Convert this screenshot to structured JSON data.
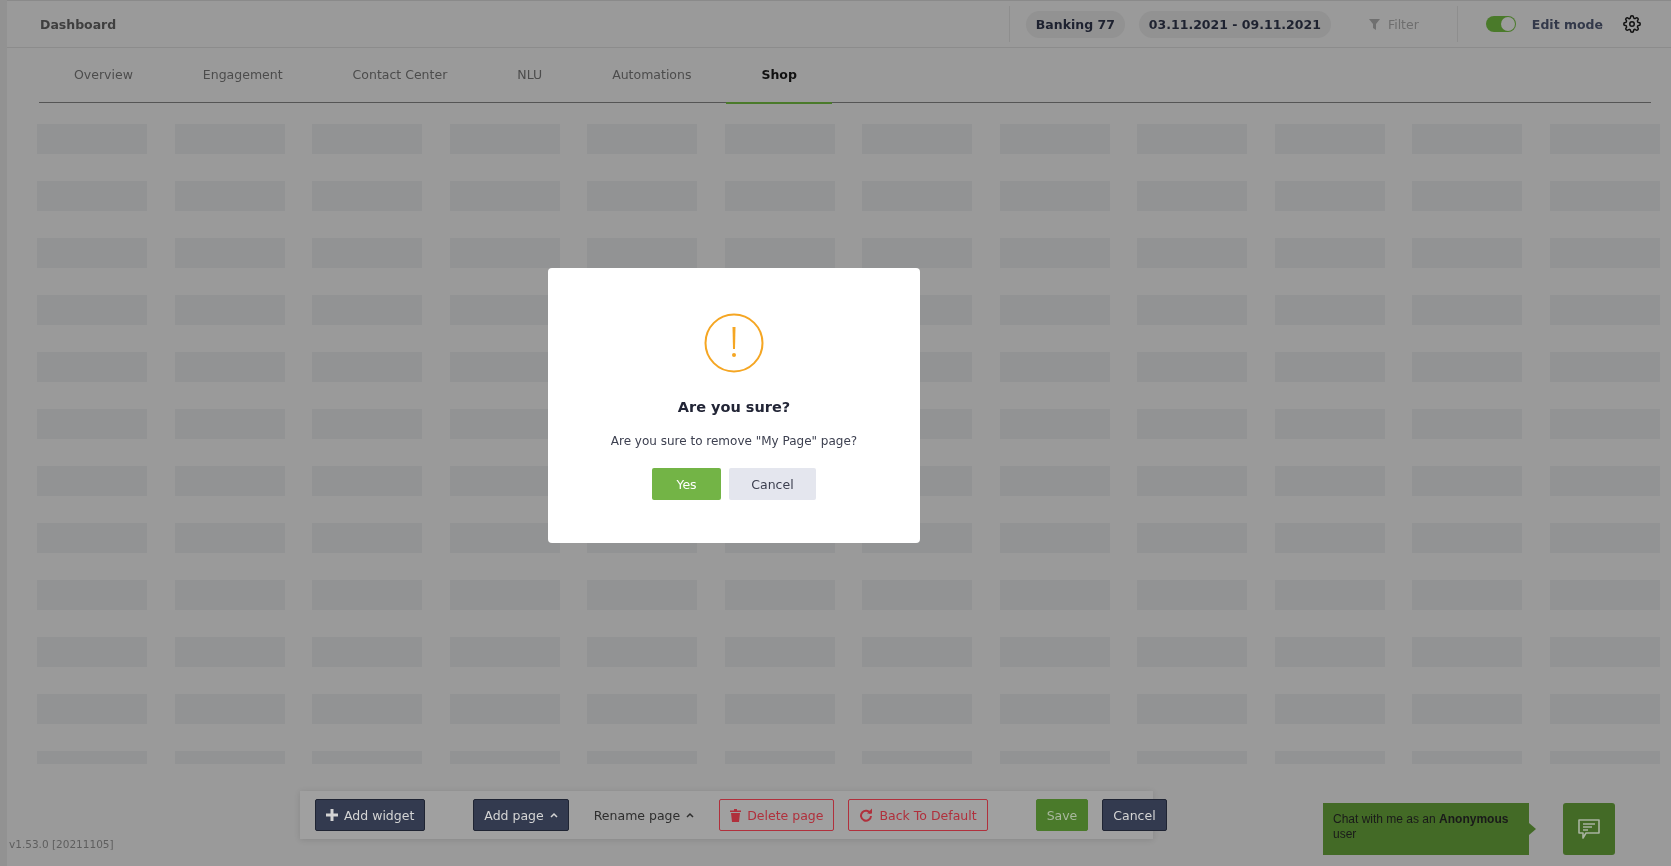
{
  "header": {
    "title": "Dashboard",
    "bot": "Banking 77",
    "date_range": "03.11.2021 - 09.11.2021",
    "filter": "Filter",
    "edit_mode": {
      "label": "Edit mode",
      "on": true
    }
  },
  "tabs": [
    {
      "label": "Overview",
      "selected": false
    },
    {
      "label": "Engagement",
      "selected": false
    },
    {
      "label": "Contact Center",
      "selected": false
    },
    {
      "label": "NLU",
      "selected": false
    },
    {
      "label": "Automations",
      "selected": false
    },
    {
      "label": "Shop",
      "selected": true
    }
  ],
  "toolbar": {
    "buttons": [
      {
        "label": "Add widget",
        "kind": "add"
      },
      {
        "kind": "divider"
      },
      {
        "label": "Add page",
        "kind": "menu"
      },
      {
        "label": "Rename page",
        "kind": "text-menu"
      },
      {
        "label": "Delete page",
        "kind": "delete"
      },
      {
        "label": "Back To Default",
        "kind": "reset"
      },
      {
        "kind": "divider"
      },
      {
        "label": "Save",
        "kind": "save"
      },
      {
        "label": "Cancel",
        "kind": "cancel"
      }
    ]
  },
  "version": "v1.53.0 [20211105]",
  "chat": {
    "message": "Chat with me as an **Anonymous** user"
  },
  "dialog": {
    "title": "Are you sure?",
    "message": "Are you sure to remove \"My Page\" page?",
    "buttons": [
      {
        "label": "Yes",
        "kind": "confirm"
      },
      {
        "label": "Cancel",
        "kind": "dismiss"
      }
    ]
  }
}
